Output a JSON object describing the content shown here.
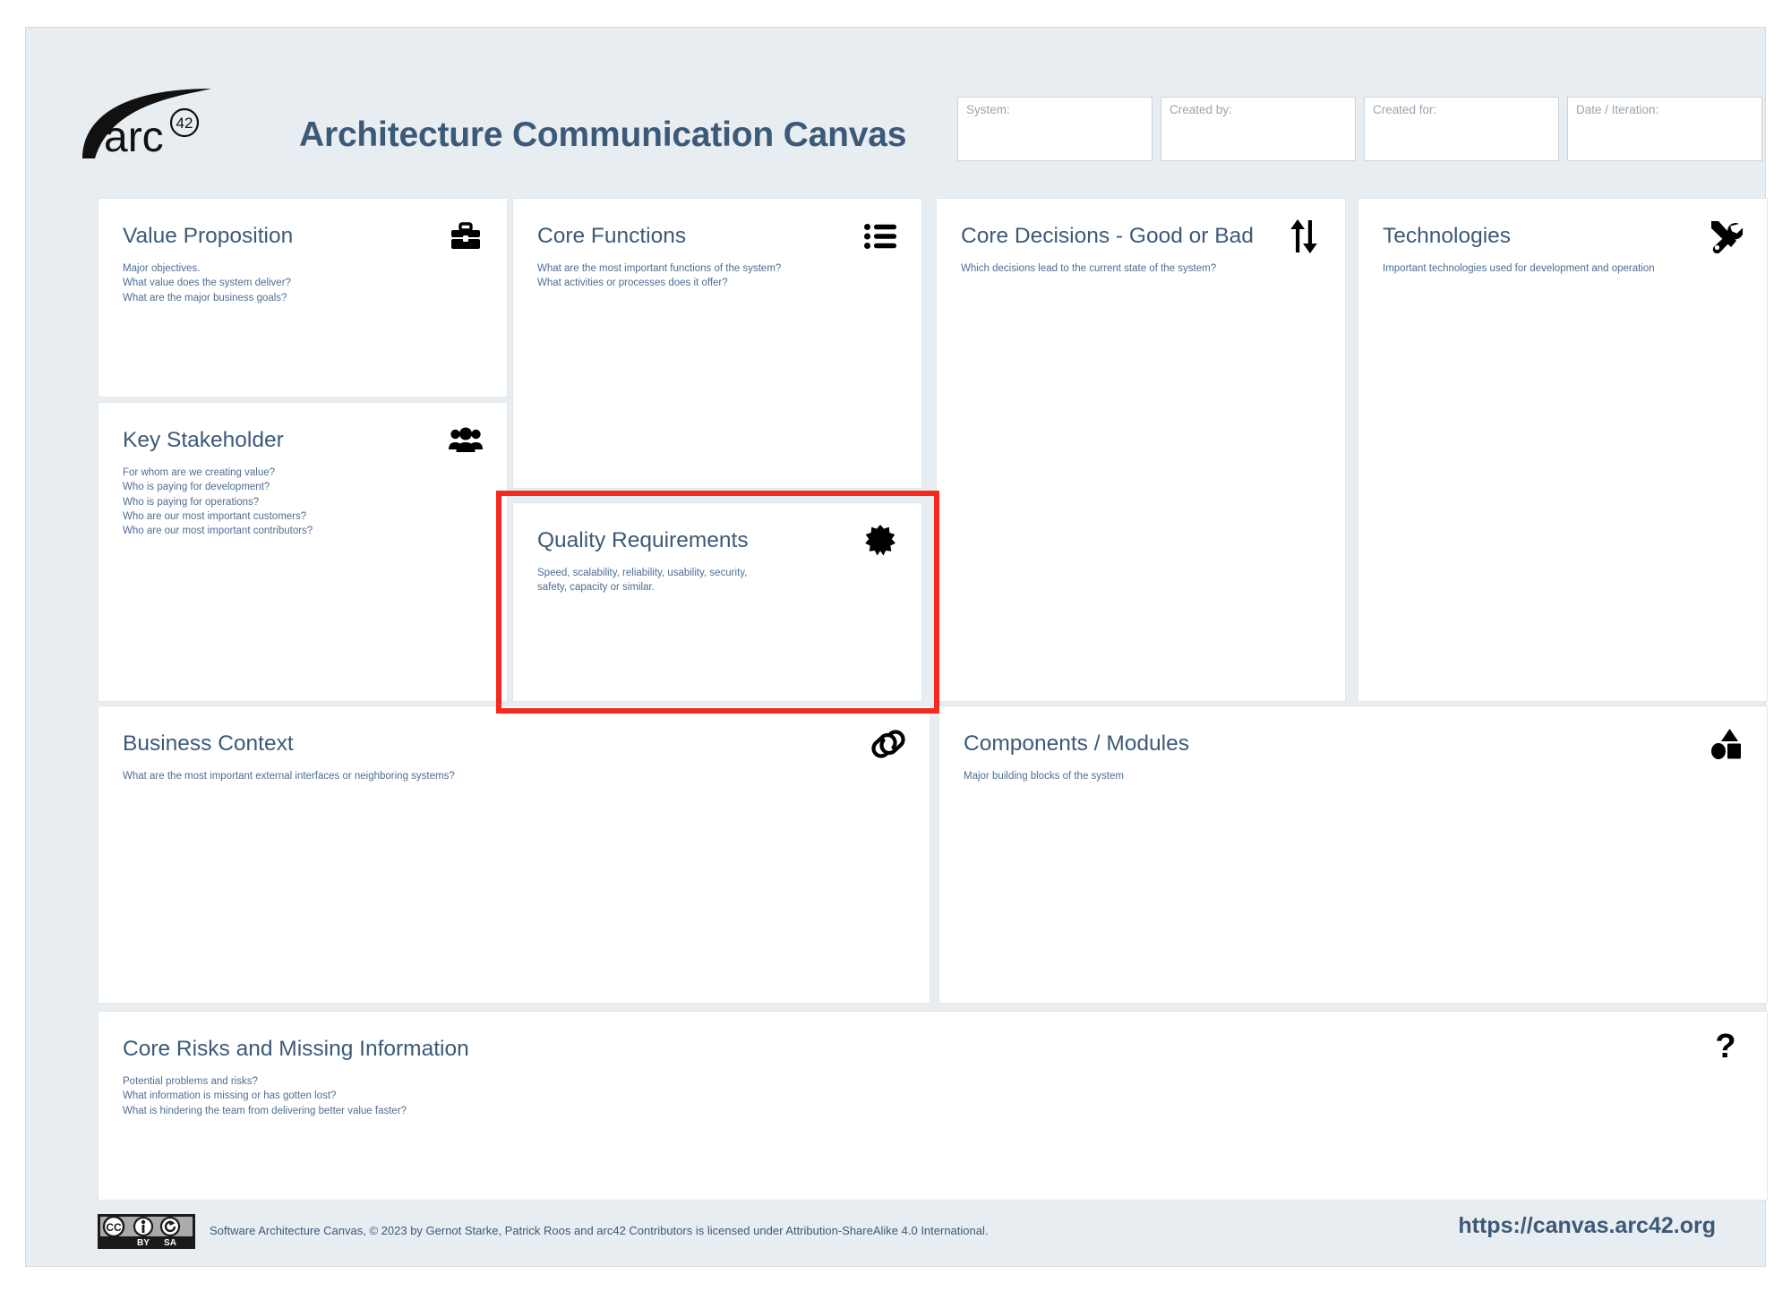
{
  "header": {
    "logo_alt": "arc42",
    "logo_word": "arc",
    "logo_sup": "42",
    "title": "Architecture Communication Canvas",
    "meta_fields": [
      {
        "name": "system",
        "label": "System:",
        "value": ""
      },
      {
        "name": "created-by",
        "label": "Created by:",
        "value": ""
      },
      {
        "name": "created-for",
        "label": "Created for:",
        "value": ""
      },
      {
        "name": "date-iteration",
        "label": "Date / Iteration:",
        "value": ""
      }
    ]
  },
  "cards": {
    "value_proposition": {
      "title": "Value Proposition",
      "hint": "Major objectives.\nWhat value does the system deliver?\nWhat are the major business goals?",
      "icon": "briefcase-icon",
      "content": ""
    },
    "key_stakeholder": {
      "title": "Key Stakeholder",
      "hint": "For whom are we creating value?\nWho is paying for development?\nWho is paying for operations?\nWho are our most important customers?\nWho are our most important contributors?",
      "icon": "people-group-icon",
      "content": ""
    },
    "core_functions": {
      "title": "Core Functions",
      "hint": "What are the most important functions of the system?\nWhat activities or processes does it offer?",
      "icon": "bullet-list-icon",
      "content": ""
    },
    "quality_requirements": {
      "title": "Quality Requirements",
      "hint": "Speed, scalability, reliability, usability, security,\nsafety, capacity or similar.",
      "icon": "starburst-icon",
      "content": "",
      "highlighted": true
    },
    "core_decisions": {
      "title": "Core Decisions - Good or Bad",
      "hint": "Which decisions lead to the current state of the system?",
      "icon": "up-down-arrows-icon",
      "content": ""
    },
    "technologies": {
      "title": "Technologies",
      "hint": "Important technologies used for development and operation",
      "icon": "tools-icon",
      "content": ""
    },
    "business_context": {
      "title": "Business Context",
      "hint": "What are the most important external interfaces or neighboring systems?",
      "icon": "link-chain-icon",
      "content": ""
    },
    "components_modules": {
      "title": "Components / Modules",
      "hint": "Major building blocks of the system",
      "icon": "shapes-icon",
      "content": ""
    },
    "core_risks": {
      "title": "Core Risks and Missing Information",
      "hint": "Potential problems and risks?\nWhat information is missing or has gotten lost?\nWhat is hindering the team from delivering better value faster?",
      "icon": "question-mark-icon",
      "content": ""
    }
  },
  "footer": {
    "license_badge": "cc-by-sa-icon",
    "license_badge_labels": {
      "cc": "CC",
      "by": "BY",
      "sa": "SA"
    },
    "license_text": "Software Architecture Canvas, © 2023 by Gernot Starke, Patrick Roos and arc42 Contributors is licensed under Attribution-ShareAlike 4.0 International.",
    "url": "https://canvas.arc42.org"
  },
  "colors": {
    "background": "#e8edf1",
    "card_background": "#ffffff",
    "title_blue": "#3c5a78",
    "hint_blue": "#4d6e92",
    "placeholder_gray": "#9aa4ad",
    "highlight_red": "#f5291c",
    "card_border": "#e2e7eb"
  }
}
